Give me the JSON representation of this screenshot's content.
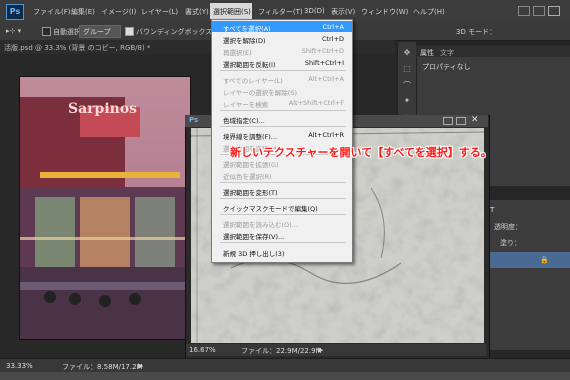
{
  "app": {
    "logo": "Ps"
  },
  "menubar": {
    "items": [
      "ファイル(F)",
      "編集(E)",
      "イメージ(I)",
      "レイヤー(L)",
      "書式(Y)",
      "選択範囲(S)",
      "フィルター(T)",
      "3D(D)",
      "表示(V)",
      "ウィンドウ(W)",
      "ヘルプ(H)"
    ]
  },
  "options": {
    "auto_select": "自動選択：",
    "group": "グループ",
    "bounding_box": "バウンディングボックスを表",
    "mode_3d": "3D モード："
  },
  "document": {
    "tab_title": "活版.psd @ 33.3% (背景 のコピー, RGB/8) *",
    "zoom": "33.33%",
    "file_info": "ファイル：8.58M/17.2M"
  },
  "panels": {
    "properties_tab": "属性",
    "character_tab": "文字",
    "properties_text": "プロパティなし",
    "opacity_label": "透明度：",
    "fill_label": "塗り："
  },
  "texture_window": {
    "zoom": "16.67%",
    "file_info": "ファイル：22.9M/22.9M"
  },
  "dropdown": {
    "items": [
      {
        "label": "すべてを選択(A)",
        "shortcut": "Ctrl+A",
        "state": "highlighted"
      },
      {
        "label": "選択を解除(D)",
        "shortcut": "Ctrl+D",
        "state": "enabled"
      },
      {
        "label": "再選択(E)",
        "shortcut": "Shift+Ctrl+D",
        "state": "disabled"
      },
      {
        "label": "選択範囲を反転(I)",
        "shortcut": "Shift+Ctrl+I",
        "state": "enabled"
      },
      {
        "label": "すべてのレイヤー(L)",
        "shortcut": "Alt+Ctrl+A",
        "state": "disabled"
      },
      {
        "label": "レイヤーの選択を解除(S)",
        "shortcut": "",
        "state": "disabled"
      },
      {
        "label": "レイヤーを検索",
        "shortcut": "Alt+Shift+Ctrl+F",
        "state": "disabled"
      },
      {
        "label": "色域指定(C)...",
        "shortcut": "",
        "state": "enabled"
      },
      {
        "label": "境界線を調整(F)...",
        "shortcut": "Alt+Ctrl+R",
        "state": "enabled"
      },
      {
        "label": "選択範囲を変更(M)",
        "shortcut": "",
        "state": "disabled"
      },
      {
        "label": "選択範囲を拡張(G)",
        "shortcut": "",
        "state": "disabled"
      },
      {
        "label": "近似色を選択(R)",
        "shortcut": "",
        "state": "disabled"
      },
      {
        "label": "選択範囲を変形(T)",
        "shortcut": "",
        "state": "enabled"
      },
      {
        "label": "クイックマスクモードで編集(Q)",
        "shortcut": "",
        "state": "enabled"
      },
      {
        "label": "選択範囲を読み込む(O)...",
        "shortcut": "",
        "state": "disabled"
      },
      {
        "label": "選択範囲を保存(V)...",
        "shortcut": "",
        "state": "enabled"
      },
      {
        "label": "新規 3D 押し出し(3)",
        "shortcut": "",
        "state": "enabled"
      }
    ]
  },
  "annotation": {
    "text": "新しいテクスチャーを開いて【すべてを選択】する。",
    "color": "#ff1a1a"
  },
  "photo": {
    "sign_text": "Sarpinos"
  }
}
